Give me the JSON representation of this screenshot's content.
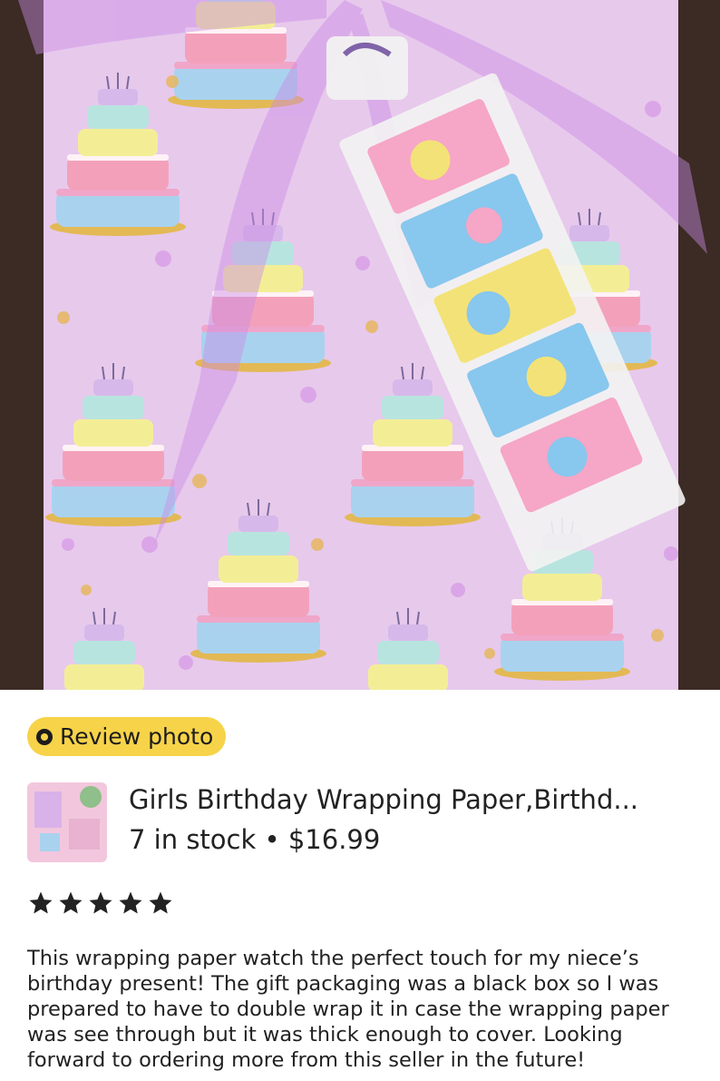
{
  "review_badge": {
    "label": "Review photo",
    "icon": "camera-review-icon"
  },
  "product": {
    "title": "Girls Birthday Wrapping Paper,Birthd...",
    "stock": "7 in stock",
    "separator": "•",
    "price": "$16.99"
  },
  "rating": {
    "stars": 5,
    "max": 5,
    "color": "#222222"
  },
  "review": {
    "text": "This wrapping paper watch the perfect touch for my niece’s birthday present! The gift packaging was a black box so I was prepared to have to double wrap it in case the wrapping paper was see through but it was thick enough to cover. Looking forward to ordering more from this seller in the future!"
  },
  "colors": {
    "badge": "#f7d34a",
    "paper": "#e7c9ec",
    "ribbon": "#c98be6"
  }
}
